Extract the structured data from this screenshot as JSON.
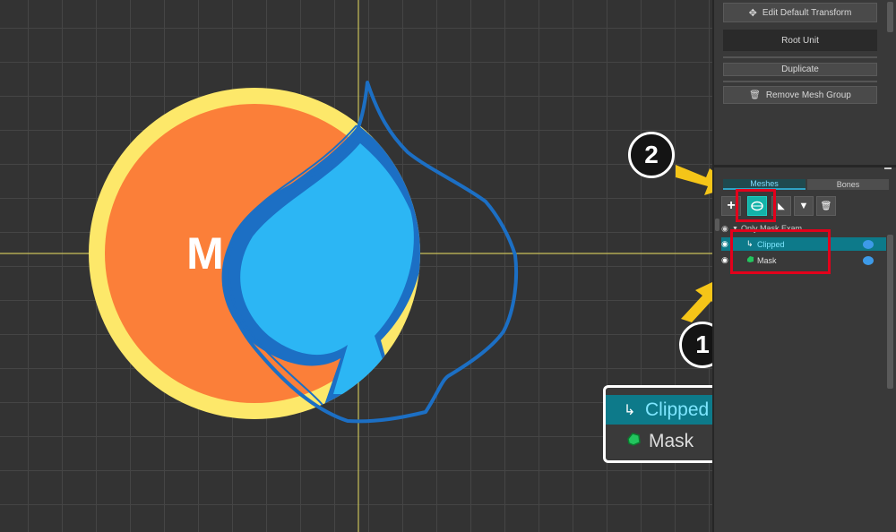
{
  "canvas": {
    "label_m": "M"
  },
  "panel": {
    "edit_default_transform": "Edit Default Transform",
    "root_unit": "Root Unit",
    "duplicate": "Duplicate",
    "remove_mesh_group": "Remove Mesh Group",
    "tabs": {
      "meshes": "Meshes",
      "bones": "Bones"
    },
    "tree": {
      "group": "Only Mask Exam...",
      "clipped": "Clipped",
      "mask": "Mask"
    }
  },
  "callout": {
    "clipped": "Clipped",
    "mask": "Mask",
    "step1": "1",
    "step2": "2"
  },
  "colors": {
    "background": "#333333",
    "panel": "#393939",
    "selection_teal": "#0d7a8a",
    "highlight_red": "#e3001b",
    "arrow_yellow": "#f5c518"
  }
}
